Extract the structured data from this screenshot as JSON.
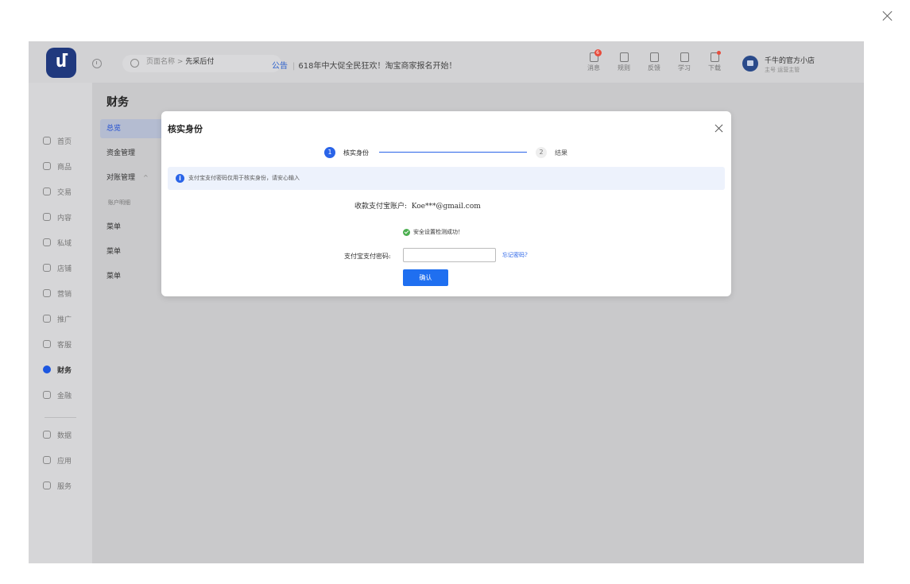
{
  "app": {
    "logo_glyph": "ʹ",
    "search": {
      "placeholder": ""
    },
    "notice": {
      "tag": "公告",
      "text": "618年中大促全民狂欢！淘宝商家报名开始！"
    },
    "tools": [
      {
        "label": "消息",
        "icon": "message-icon",
        "badge": "6"
      },
      {
        "label": "规则",
        "icon": "rules-icon"
      },
      {
        "label": "反馈",
        "icon": "feedback-icon"
      },
      {
        "label": "学习",
        "icon": "learn-icon"
      },
      {
        "label": "下载",
        "icon": "download-icon",
        "dot": true
      }
    ],
    "shop": {
      "name": "千牛的官方小店",
      "sub": "主号  运营主管"
    }
  },
  "leftnav": {
    "items": [
      {
        "label": "首页",
        "icon": "home-icon"
      },
      {
        "label": "商品",
        "icon": "goods-icon"
      },
      {
        "label": "交易",
        "icon": "trade-icon"
      },
      {
        "label": "内容",
        "icon": "content-icon"
      },
      {
        "label": "私域",
        "icon": "private-domain-icon"
      },
      {
        "label": "店铺",
        "icon": "store-icon"
      },
      {
        "label": "营销",
        "icon": "marketing-icon"
      },
      {
        "label": "推广",
        "icon": "promotion-icon"
      },
      {
        "label": "客服",
        "icon": "service-icon"
      },
      {
        "label": "财务",
        "icon": "finance-icon",
        "active": true
      },
      {
        "label": "金融",
        "icon": "financial-icon"
      },
      {
        "label": "数据",
        "icon": "data-icon"
      },
      {
        "label": "应用",
        "icon": "apps-icon"
      },
      {
        "label": "服务",
        "icon": "services-icon"
      }
    ]
  },
  "subnav": {
    "title": "财务",
    "items": [
      {
        "label": "总览",
        "active": true
      },
      {
        "label": "资金管理"
      },
      {
        "label": "对账管理",
        "expand": "^"
      },
      {
        "label": "账户明细",
        "small": true
      },
      {
        "label": "菜单"
      },
      {
        "label": "菜单"
      },
      {
        "label": "菜单"
      }
    ]
  },
  "breadcrumb": {
    "parent": "页面名称",
    "separator": ">",
    "current": "先采后付"
  },
  "modal": {
    "title": "核实身份",
    "steps": [
      {
        "num": "1",
        "label": "核实身份"
      },
      {
        "num": "2",
        "label": "结果"
      }
    ],
    "info": "支付宝支付密码仅用于核实身份，请安心输入",
    "account_label": "收款支付宝账户:",
    "account_value": "Koe***@gmail.com",
    "success_text": "安全设置检测成功！",
    "password_label": "支付宝支付密码:",
    "password_value": "",
    "forgot_label": "忘记密码?",
    "confirm_label": "确认"
  },
  "colors": {
    "accent": "#1f6ff0",
    "logo_bg": "#20397e",
    "badge": "#e74c3c",
    "success": "#4caf50"
  }
}
